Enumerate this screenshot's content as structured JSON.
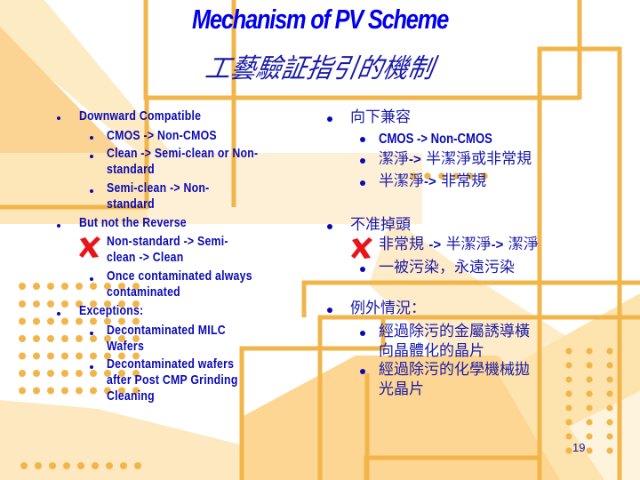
{
  "slide": {
    "title_en": "Mechanism of PV Scheme",
    "title_zh": "工藝驗証指引的機制",
    "page_number": "19",
    "colors": {
      "text": "#0a0ab4",
      "title": "#0000ee",
      "accent_orange": "#f2b54a",
      "light_orange": "#fde2aa",
      "cross_red": "#e8141a"
    }
  },
  "left": {
    "items": [
      {
        "level": 1,
        "text": "Downward Compatible"
      },
      {
        "level": 2,
        "text": "CMOS -> Non-CMOS"
      },
      {
        "level": 2,
        "text": "Clean -> Semi-clean or Non-",
        "cont": "standard"
      },
      {
        "level": 2,
        "text": "Semi-clean -> Non-",
        "cont": "standard"
      },
      {
        "level": 1,
        "text": "But not the Reverse"
      },
      {
        "level": 2,
        "marker": "cross-icon",
        "text": "Non-standard -> Semi-",
        "cont": "clean -> Clean"
      },
      {
        "level": 2,
        "text": "Once contaminated always",
        "cont": "contaminated"
      },
      {
        "level": 1,
        "text": "Exceptions:"
      },
      {
        "level": 2,
        "text": "Decontaminated MILC",
        "cont": "Wafers"
      },
      {
        "level": 2,
        "text": "Decontaminated wafers",
        "cont": "after Post CMP Grinding",
        "cont2": "Cleaning"
      }
    ]
  },
  "right": {
    "items": [
      {
        "level": 1,
        "text": "向下兼容"
      },
      {
        "level": 2,
        "text": "CMOS -> Non-CMOS"
      },
      {
        "level": 2,
        "text_a": "潔淨",
        "arrow": "->",
        "text_b": " 半潔淨或非常規"
      },
      {
        "level": 2,
        "text_a": "半潔淨",
        "arrow": "->",
        "text_b": " 非常規"
      },
      {
        "level": 1,
        "text": "不准掉頭"
      },
      {
        "level": 2,
        "marker": "cross-icon",
        "text_a": "非常規 ",
        "arrow": "->",
        "text_b": " 半潔淨",
        "arrow2": "->",
        "text_c": " 潔淨"
      },
      {
        "level": 2,
        "text": "一被污染，永遠污染"
      },
      {
        "level": 1,
        "text": "例外情況："
      },
      {
        "level": 2,
        "text": "經過除污的金屬誘導橫",
        "cont": "向晶體化的晶片"
      },
      {
        "level": 2,
        "text": "經過除污的化學機械拋",
        "cont": "光晶片"
      }
    ]
  }
}
